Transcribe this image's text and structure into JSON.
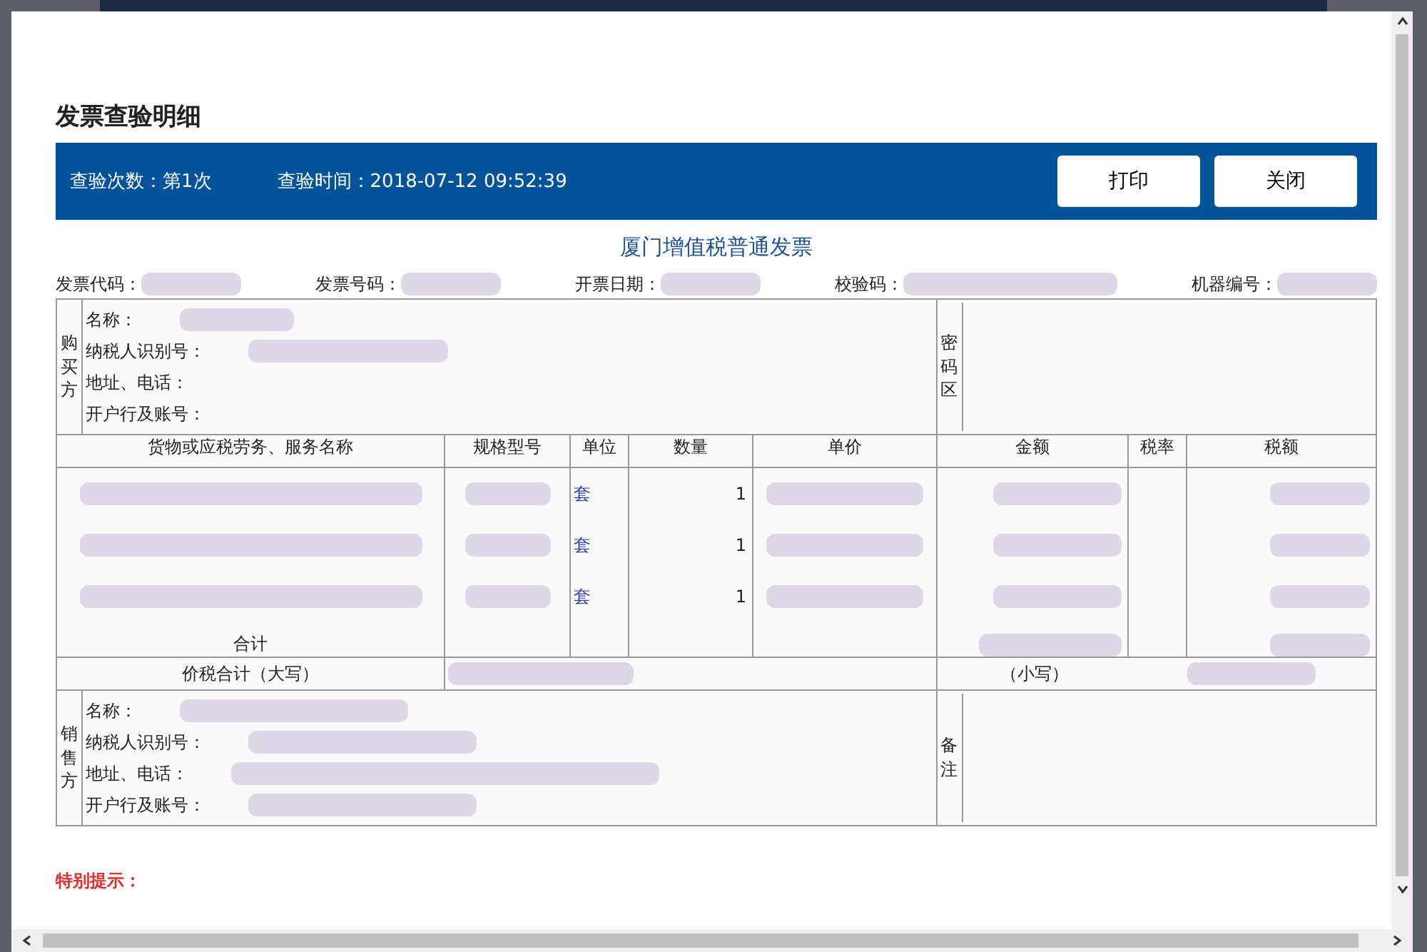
{
  "title": "发票查验明细",
  "bar": {
    "count_label": "查验次数：",
    "count": "第1次",
    "time_label": "查验时间：",
    "time": "2018-07-12 09:52:39",
    "buttons": [
      "打印",
      "关闭"
    ]
  },
  "invoice": {
    "title": "厦门增值税普通发票",
    "meta": [
      "发票代码：",
      "发票号码：",
      "开票日期：",
      "校验码：",
      "机器编号："
    ],
    "buyer": {
      "side": "购买方",
      "fields": [
        "名称：",
        "纳税人识别号：",
        "地址、电话：",
        "开户行及账号："
      ],
      "code_area": "密码区"
    },
    "columns": [
      "货物或应税劳务、服务名称",
      "规格型号",
      "单位",
      "数量",
      "单价",
      "金额",
      "税率",
      "税额"
    ],
    "items": [
      {
        "unit": "套",
        "quantity": "1"
      },
      {
        "unit": "套",
        "quantity": "1"
      },
      {
        "unit": "套",
        "quantity": "1"
      }
    ],
    "total_label": "合计",
    "grand_total": {
      "upper_label": "价税合计（大写）",
      "lower_label": "（小写）"
    },
    "seller": {
      "side": "销售方",
      "fields": [
        "名称：",
        "纳税人识别号：",
        "地址、电话：",
        "开户行及账号："
      ],
      "remark": "备注"
    }
  },
  "notice": "特别提示："
}
